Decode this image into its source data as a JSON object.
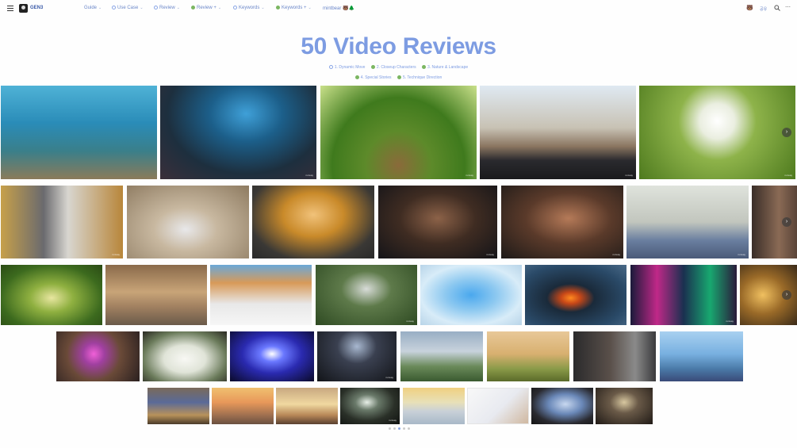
{
  "brand": "GEN3",
  "nav": [
    {
      "label": "Guide",
      "icon": "",
      "caret": true
    },
    {
      "label": "Use Case",
      "icon": "globe",
      "caret": true
    },
    {
      "label": "Review",
      "icon": "globe",
      "caret": true
    },
    {
      "label": "Review +",
      "icon": "leaf",
      "caret": true
    },
    {
      "label": "Keywords",
      "icon": "globe",
      "caret": true
    },
    {
      "label": "Keywords +",
      "icon": "leaf",
      "caret": true
    },
    {
      "label": "mintbear 🐻🌲",
      "icon": "",
      "caret": false
    }
  ],
  "right": {
    "lang": "공유",
    "search_icon": "search-icon",
    "more_icon": "more-icon"
  },
  "title": "50 Video Reviews",
  "tags_row1": [
    "1. Dynamic Move",
    "2. Closeup Characters",
    "3. Nature & Landscape"
  ],
  "tags_row2": [
    "4. Special Stories",
    "5. Technique Direction"
  ],
  "watermark": "runway",
  "colors": {
    "accent": "#7d9ce2",
    "nav": "#6b87c9",
    "leaf": "#7bb661",
    "globe": "#8aa6e6"
  },
  "rows": [
    {
      "name": "row-1",
      "thumbs": [
        "underwater-coral-reef",
        "underwater-cave-seaweed",
        "grass-fisheye",
        "train-cab-railway",
        "dandelion-seed-head"
      ]
    },
    {
      "name": "row-2",
      "thumbs": [
        "astronaut-walking-alley",
        "astronaut-portrait",
        "curly-hair-sunglasses-man",
        "man-closeup-face",
        "woman-closeup-face",
        "girl-in-gym",
        "man-partial-face"
      ]
    },
    {
      "name": "row-3",
      "thumbs": [
        "overgrown-green-corridor",
        "church-interior",
        "venice-canal-wave",
        "figure-in-forest",
        "blue-furry-creature",
        "lava-crater-sea",
        "neon-forest",
        "golden-ruins"
      ]
    },
    {
      "name": "row-4",
      "thumbs": [
        "magic-portal-market",
        "spiky-white-orb",
        "blue-light-tunnel",
        "silhouette-backlight",
        "rocket-launch-watcher",
        "heron-in-field",
        "woman-at-window",
        "anime-girl-sea"
      ]
    },
    {
      "name": "row-5",
      "thumbs": [
        "balloon-in-alley",
        "balloon-over-desert",
        "sunset-interior",
        "cave-flashlight",
        "snowy-hill",
        "sketch-drawing-hand",
        "window-night-city",
        "dark-room-window"
      ]
    }
  ]
}
